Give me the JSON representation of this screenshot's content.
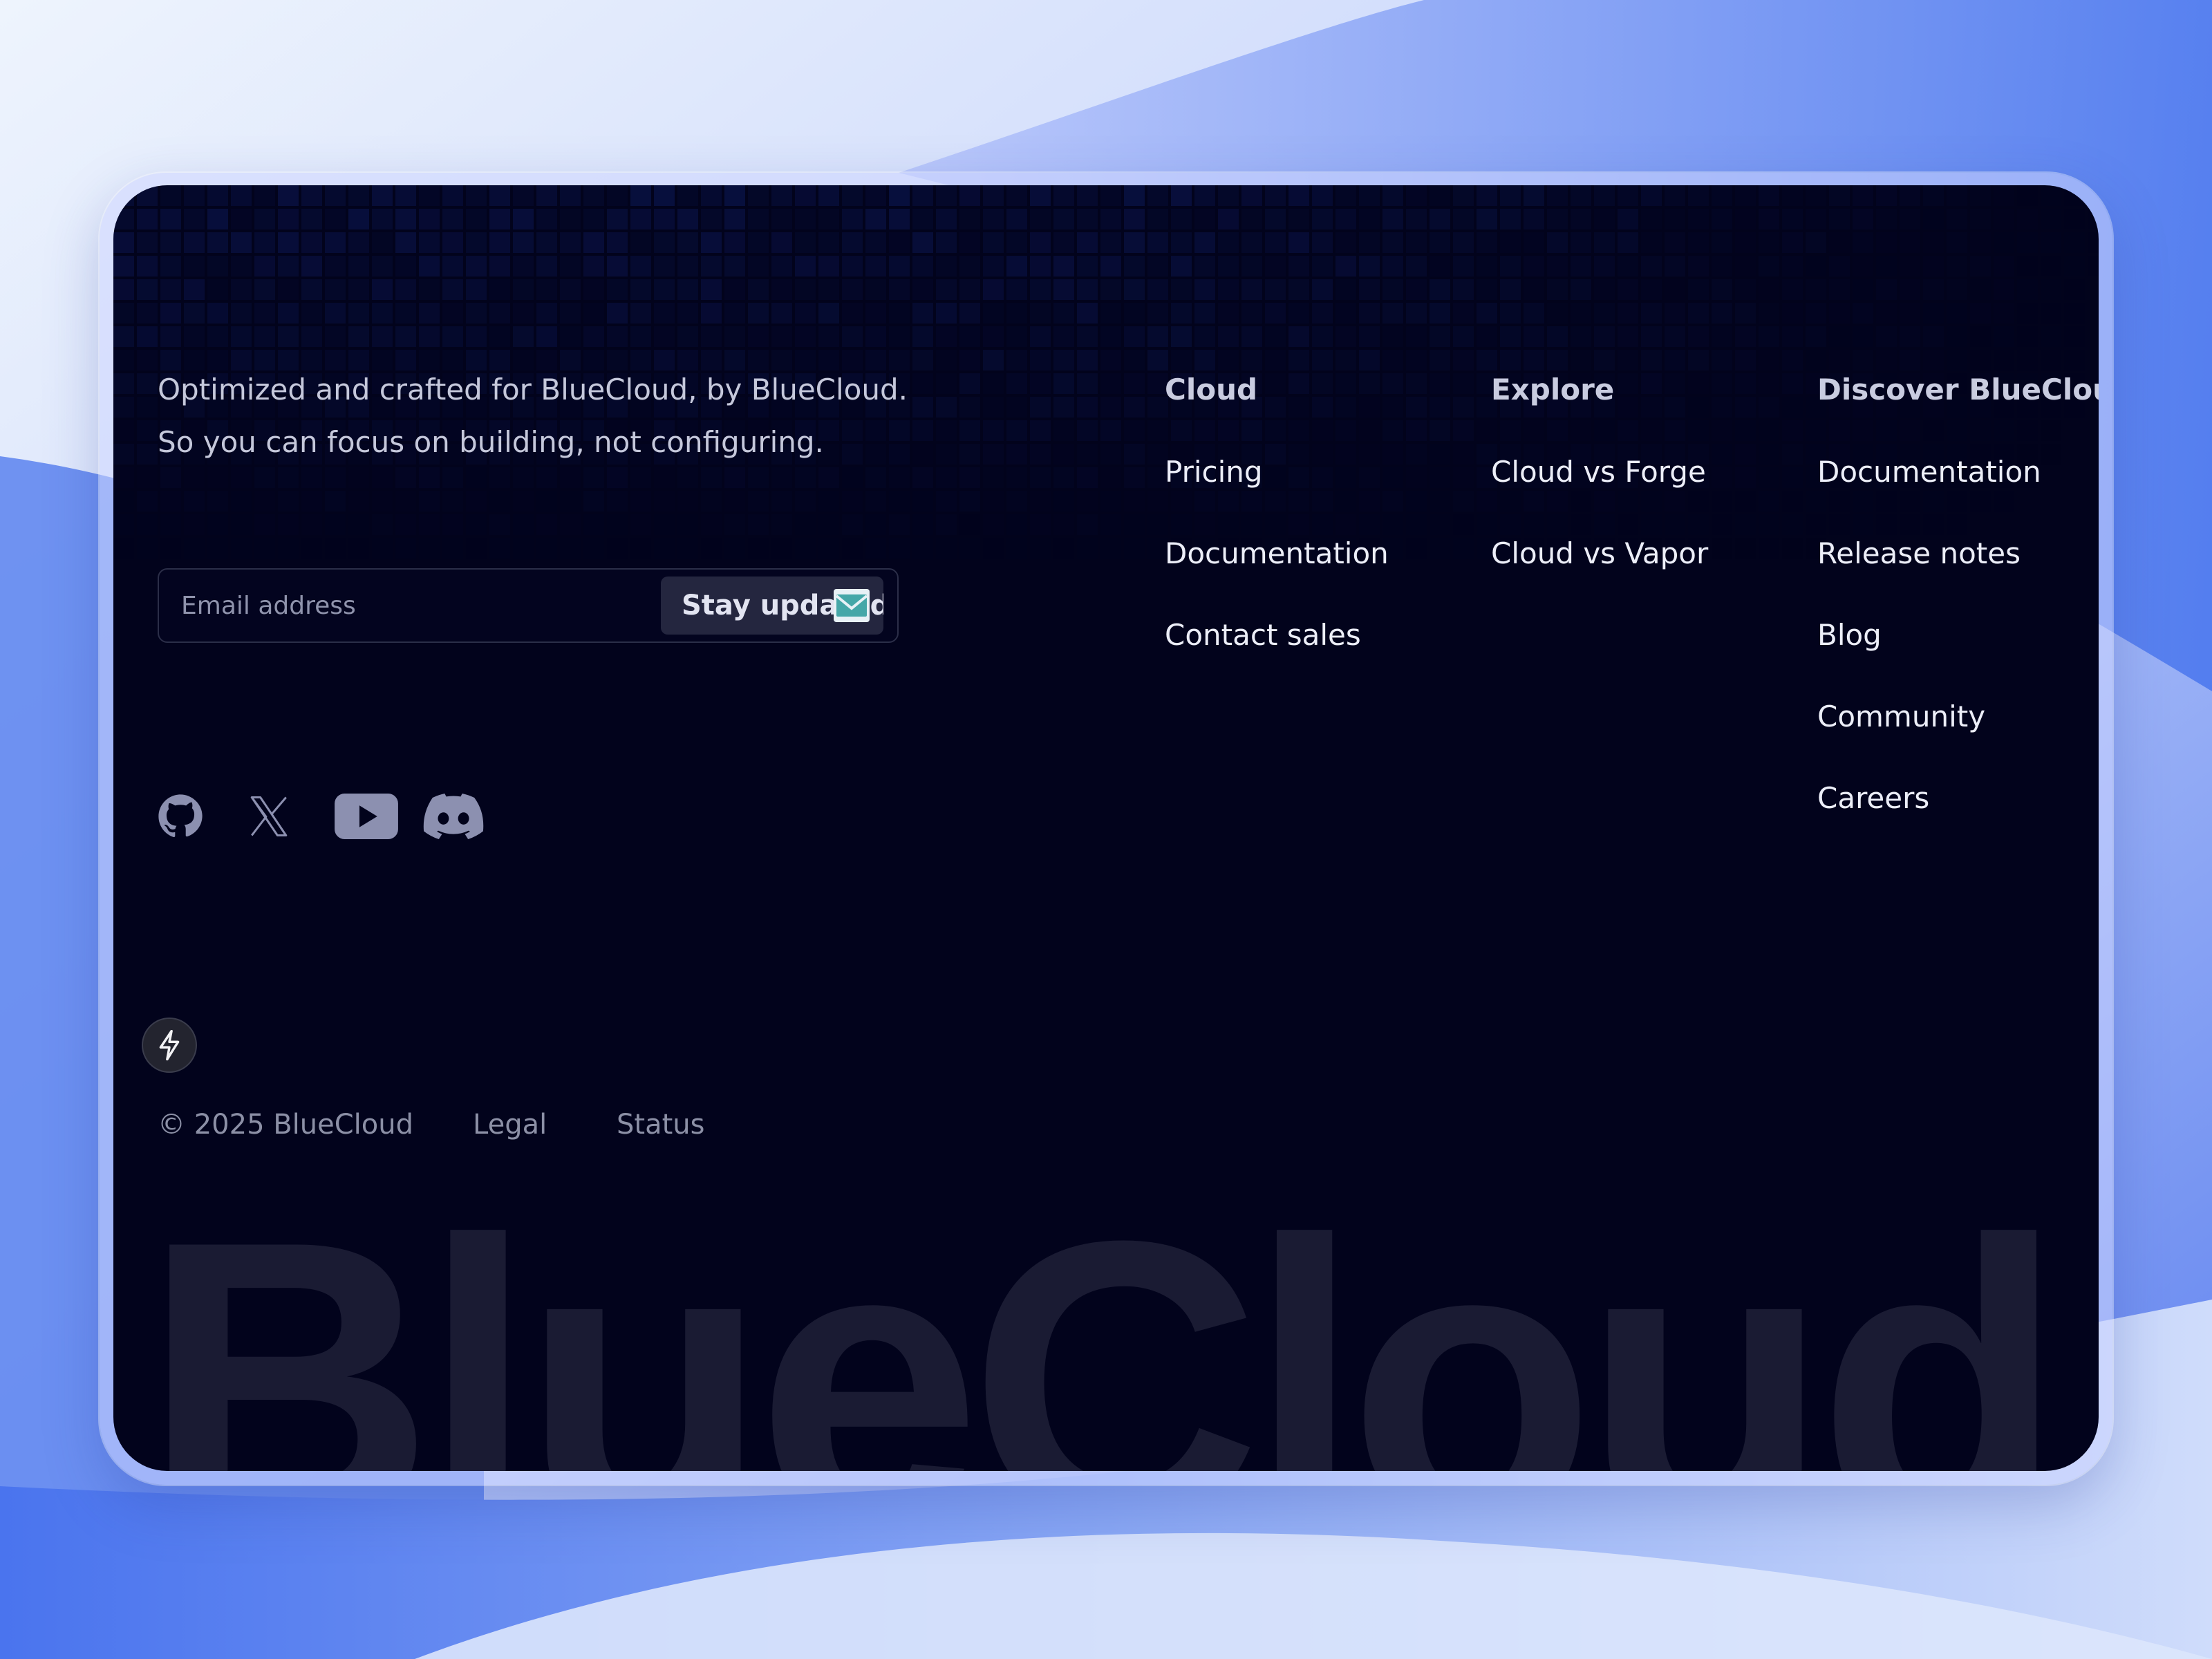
{
  "brand": {
    "tagline_line1": "Optimized and crafted for BlueCloud, by BlueCloud.",
    "tagline_line2": "So you can focus on building, not configuring.",
    "watermark": "BlueCloud"
  },
  "newsletter": {
    "email_placeholder": "Email address",
    "email_value": "",
    "button_label": "Stay updated",
    "button_icon": "envelope-icon"
  },
  "socials": [
    {
      "name": "github",
      "icon": "github-icon"
    },
    {
      "name": "x",
      "icon": "x-icon"
    },
    {
      "name": "youtube",
      "icon": "youtube-icon"
    },
    {
      "name": "discord",
      "icon": "discord-icon"
    }
  ],
  "columns": [
    {
      "title": "Cloud",
      "links": [
        "Pricing",
        "Documentation",
        "Contact sales"
      ]
    },
    {
      "title": "Explore",
      "links": [
        "Cloud vs Forge",
        "Cloud vs Vapor"
      ]
    },
    {
      "title": "Discover BlueCloud",
      "links": [
        "Documentation",
        "Release notes",
        "Blog",
        "Community",
        "Careers"
      ]
    }
  ],
  "footer": {
    "copyright": "© 2025 BlueCloud",
    "legal": "Legal",
    "status": "Status",
    "badge_icon": "bolt-icon"
  },
  "colors": {
    "card_background": "#02031c",
    "grid_tile": "#0d1a5a",
    "page_accent": "#3f6ee8"
  }
}
